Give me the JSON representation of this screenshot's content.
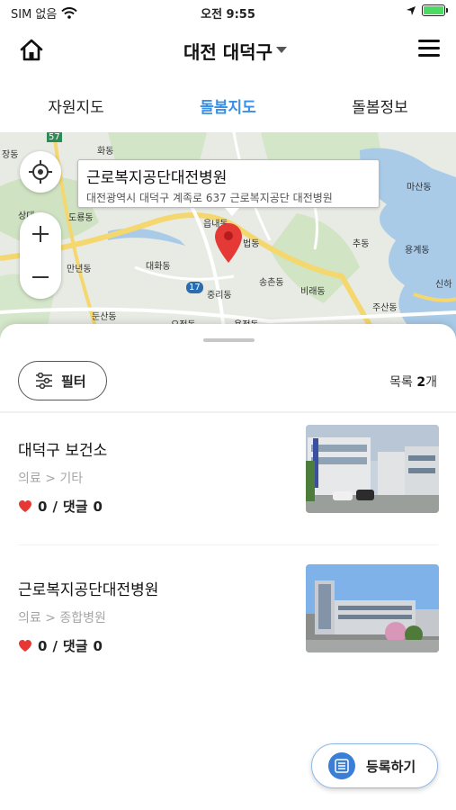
{
  "status_bar": {
    "carrier": "SIM 없음",
    "time": "오전 9:55",
    "battery_color": "#4cd964"
  },
  "header": {
    "region": "대전 대덕구",
    "home_icon": "home-icon",
    "menu_icon": "hamburger-menu-icon"
  },
  "tabs": [
    {
      "label": "자원지도",
      "active": false
    },
    {
      "label": "돌봄지도",
      "active": true
    },
    {
      "label": "돌봄정보",
      "active": false
    }
  ],
  "accent_color": "#3a8fe6",
  "map": {
    "callout_title": "근로복지공단대전병원",
    "callout_address": "대전광역시 대덕구 계족로 637 근로복지공단 대전병원",
    "labels": [
      "장동",
      "화동",
      "도룡동",
      "만년동",
      "둔산동",
      "대화동",
      "중리동",
      "송촌동",
      "비래동",
      "법동",
      "읍내동",
      "추동",
      "용계동",
      "마산동",
      "주산동",
      "신하",
      "오정동",
      "용전동",
      "상대",
      "57",
      "17"
    ],
    "pin_color": "#e53935"
  },
  "sheet": {
    "filter_label": "필터",
    "count_prefix": "목록",
    "count_value": "2",
    "count_suffix": "개",
    "items": [
      {
        "title": "대덕구 보건소",
        "category": "의료 > 기타",
        "likes": "0",
        "comment_label": "댓글",
        "comments": "0"
      },
      {
        "title": "근로복지공단대전병원",
        "category": "의료 > 종합병원",
        "likes": "0",
        "comment_label": "댓글",
        "comments": "0"
      }
    ],
    "like_color": "#e53935"
  },
  "register_label": "등록하기"
}
